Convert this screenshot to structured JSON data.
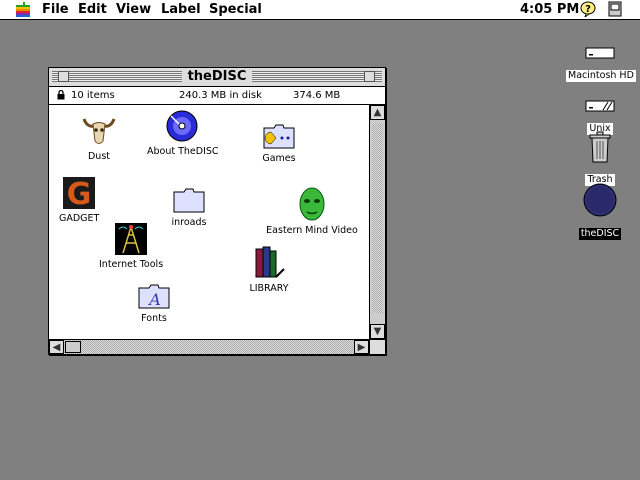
{
  "menubar": {
    "items": [
      "File",
      "Edit",
      "View",
      "Label",
      "Special"
    ],
    "clock": "4:05 PM"
  },
  "window": {
    "title": "theDISC",
    "info": {
      "items": "10 items",
      "in_disk": "240.3 MB in disk",
      "available": "374.6 MB available"
    },
    "icons": [
      {
        "label": "Dust",
        "icon": "bull-skull-icon"
      },
      {
        "label": "About TheDISC",
        "icon": "blue-disc-icon"
      },
      {
        "label": "Games",
        "icon": "folder-pacman-icon"
      },
      {
        "label": "GADGET",
        "icon": "gadget-g-icon"
      },
      {
        "label": "inroads",
        "icon": "folder-icon"
      },
      {
        "label": "Eastern Mind Video",
        "icon": "green-face-icon"
      },
      {
        "label": "Internet Tools",
        "icon": "radio-tower-icon"
      },
      {
        "label": "LIBRARY",
        "icon": "books-icon"
      },
      {
        "label": "Fonts",
        "icon": "fonts-folder-icon"
      }
    ]
  },
  "desktop": {
    "icons": [
      {
        "label": "Macintosh HD",
        "icon": "hard-drive-icon"
      },
      {
        "label": "Unix",
        "icon": "hard-drive-icon"
      },
      {
        "label": "Trash",
        "icon": "trash-icon"
      },
      {
        "label": "theDISC",
        "icon": "cd-icon",
        "selected": true
      }
    ]
  },
  "colors": {
    "desktop": "#808080",
    "selection": "#000000"
  }
}
